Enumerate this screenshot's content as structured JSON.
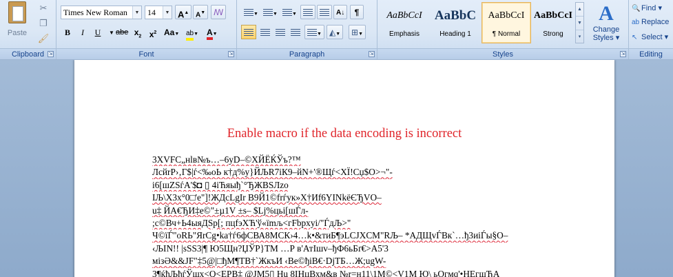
{
  "ribbon": {
    "clipboard": {
      "label": "Clipboard",
      "paste_label": "Paste",
      "icons": [
        "paste-icon",
        "cut-icon",
        "copy-icon",
        "format-painter-icon"
      ]
    },
    "font": {
      "label": "Font",
      "font_name": "Times New Roman",
      "font_size": "14",
      "grow_label": "A",
      "shrink_label": "A",
      "bold": "B",
      "italic": "I",
      "underline": "U",
      "strike": "abe",
      "subscript": "x",
      "superscript": "x",
      "change_case": "Aa",
      "highlight": "ab",
      "font_color": "A",
      "font_color_hex": "#e0242a",
      "highlight_hex": "#ffee00"
    },
    "paragraph": {
      "label": "Paragraph"
    },
    "styles": {
      "label": "Styles",
      "items": [
        {
          "sample": "AaBbCcI",
          "name": "Emphasis",
          "active": false
        },
        {
          "sample": "AaBbC",
          "name": "Heading 1",
          "active": false
        },
        {
          "sample": "AaBbCcI",
          "name": "¶ Normal",
          "active": true
        },
        {
          "sample": "AaBbCcI",
          "name": "Strong",
          "active": false
        }
      ],
      "change_styles_line1": "Change",
      "change_styles_line2": "Styles"
    },
    "editing": {
      "label": "Editing",
      "find": "Find",
      "replace": "Replace",
      "select": "Select"
    }
  },
  "document": {
    "macro_message": "Enable macro if the data encoding is incorrect",
    "message_color": "#e0242a",
    "garbled_lines": [
      "3XVFC„нlв№ъ…–6уD–©ХЙЁЌЎъ?™",
      "ЛсйrР›‚Г$|ѓ<‰оЬ к†д%у}ЙЉR7iК9–йN+'®Щѓ<ХЇ!Сџ$О>¬\"-",
      "і6[шZSѓA'$◘ ▯ 4іЋяыђ`°ЂЖBSЛzо",
      "IЉ\\X3x°0□'e\"]!ЖДсLgIr   В9Й1©frѓук»Х†Иf6YINkёЄЂVO–",
      "u‡ ЙА€ЂИ‡е©\"±µ1V   ±s– $Lj%цьі[шЃл-",
      ";c©Вч+Ь4ыяДSр[; пцfэХЋ'ў«їmљ<гFbрxуі/\"ЃдЉ>\"",
      "Ч©їЃ\"оRЬ\"ЯrCg•ka†ѓ6фСВА8МСК›4…k•&тиБ¶эLCJXCM\"RЉ– *АДЩvЃВк`…ђ3иіЃы§О–",
      "‹ЉIN!! |sSS3|¶ Ю5Щн?ЏЎР}ТМ     …Р в'АтIшv–ђФ6ьБґ€>А5'3",
      "мізӘ&&JF\"‡5@|□ђМ¶ТВ†`ЖкъИ  ‹Ве©ђіВ€·DjТБ…Ж;ugW-",
      "3¶ќђЉђѓЎщх<Q<ЕРВ‡ @JМ5▯ Hu  8ІНцВхм&в    №r=н11\\1М©<V1М Ю\\ ьОгмq'•НЕгщЂА"
    ],
    "plain_lines": [
      false,
      false,
      false,
      false,
      false,
      false,
      false,
      true,
      false,
      false
    ]
  }
}
